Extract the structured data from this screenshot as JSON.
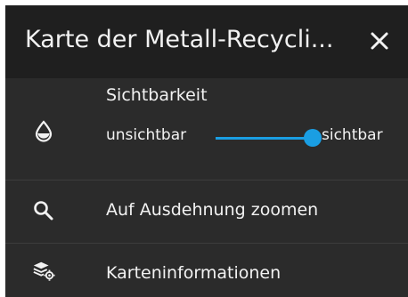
{
  "header": {
    "title": "Karte der Metall-Recycli...",
    "close_icon": "close-icon"
  },
  "visibility": {
    "icon": "opacity-drop-icon",
    "title": "Sichtbarkeit",
    "min_label": "unsichtbar",
    "max_label": "sichtbar",
    "opacity_value": 0.92,
    "accent_color": "#1a9ee3"
  },
  "menu": {
    "zoom": {
      "icon": "search-icon",
      "label": "Auf Ausdehnung zoomen"
    },
    "info": {
      "icon": "layers-settings-icon",
      "label": "Karteninformationen"
    }
  }
}
